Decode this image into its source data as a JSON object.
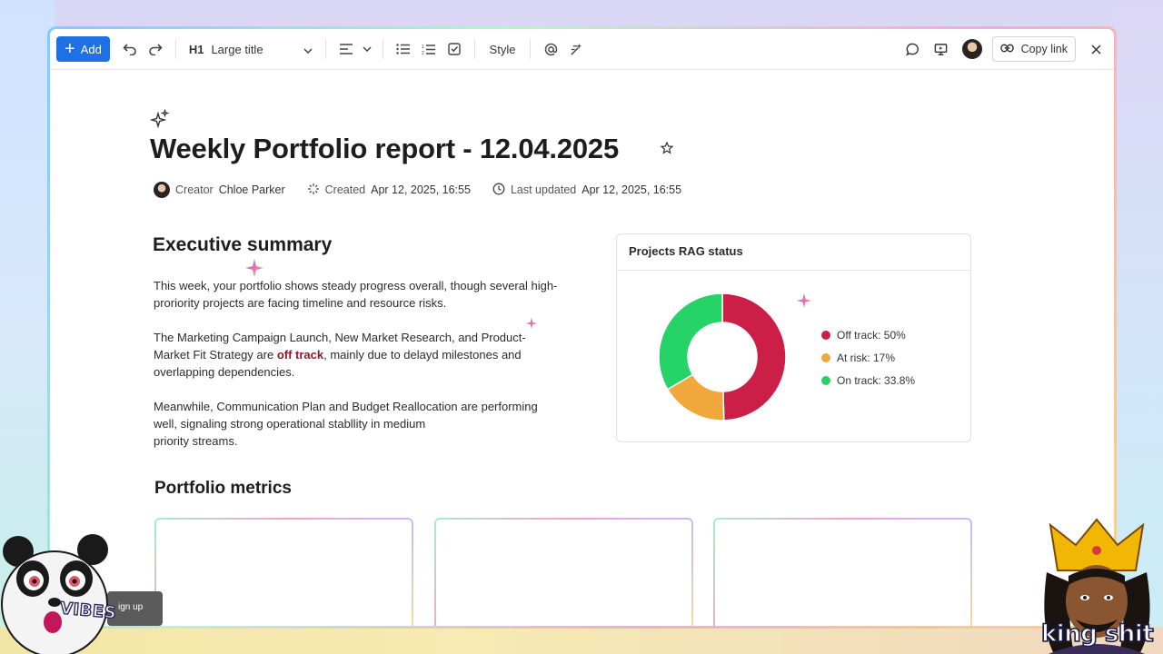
{
  "toolbar": {
    "add_label": "Add",
    "heading_style": "Large title",
    "heading_mark": "H1",
    "style_label": "Style",
    "copy_link_label": "Copy link"
  },
  "document": {
    "title": "Weekly Portfolio report - 12.04.2025",
    "creator_label": "Creator",
    "creator_name": "Chloe Parker",
    "created_label": "Created",
    "created_value": "Apr 12, 2025, 16:55",
    "updated_label": "Last updated",
    "updated_value": "Apr 12, 2025, 16:55"
  },
  "executive_summary": {
    "heading": "Executive summary",
    "p1": "This week, your portfolio shows steady progress overall, though several high-proriority projects are facing timeline and resource risks.",
    "p2_before": "The Marketing Campaign Launch, New Market Research, and Product-Market Fit Strategy are ",
    "p2_highlight": "off track",
    "p2_after": ", mainly due to delayd milestones and overlapping dependencies.",
    "p3_line1": "Meanwhile, Communication Plan and Budget Reallocation are performing",
    "p3_line2": "well, signaling strong operational stabllity in medium",
    "p3_line3": "priority streams."
  },
  "rag_card": {
    "title": "Projects RAG status",
    "legend": [
      {
        "label": "Off track: 50%",
        "color": "#cc1f47"
      },
      {
        "label": "At risk: 17%",
        "color": "#f0a83c"
      },
      {
        "label": "On track: 33.8%",
        "color": "#25d366"
      }
    ]
  },
  "chart_data": {
    "type": "pie",
    "title": "Projects RAG status",
    "categories": [
      "Off track",
      "At risk",
      "On track"
    ],
    "values": [
      50,
      17,
      33.8
    ],
    "colors": [
      "#cc1f47",
      "#f0a83c",
      "#25d366"
    ],
    "donut": true,
    "legend": "right"
  },
  "metrics": {
    "heading": "Portfolio metrics"
  },
  "overlays": {
    "signup_text": "ign up",
    "vibes_text": "VIBES",
    "king_text": "king shit"
  },
  "colors": {
    "accent": "#1f6fe5",
    "off_track_text": "#8a1a2b"
  }
}
